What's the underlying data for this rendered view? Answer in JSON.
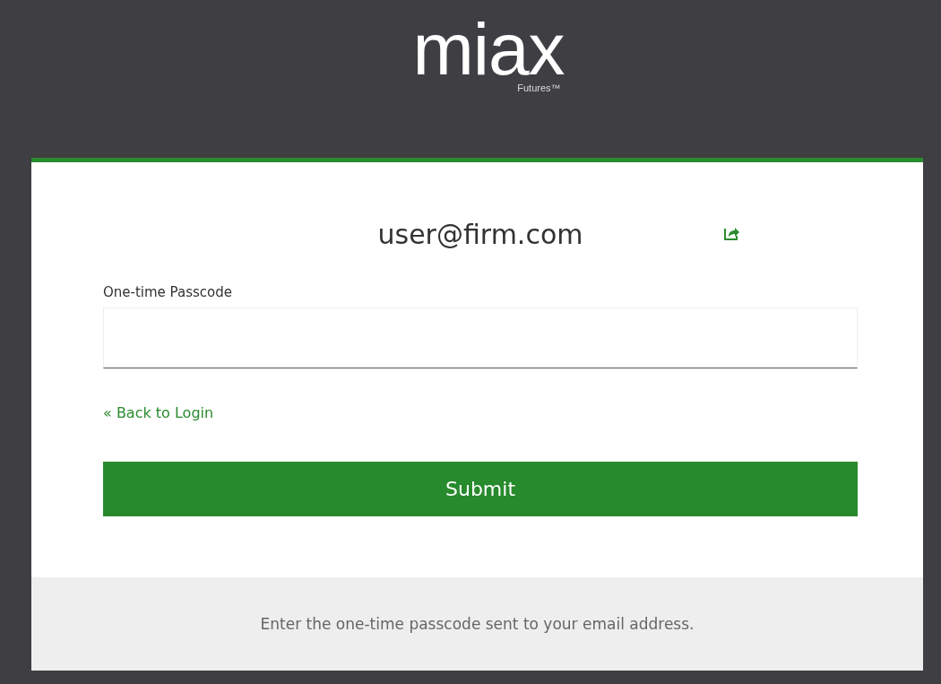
{
  "logo": {
    "wordmark": "miax",
    "subtitle": "Futures™"
  },
  "account": {
    "email": "user@firm.com"
  },
  "passcode_field": {
    "label": "One-time Passcode"
  },
  "back_link": "« Back to Login",
  "submit_button": "Submit",
  "footer": "Enter the one-time passcode sent to your email address."
}
